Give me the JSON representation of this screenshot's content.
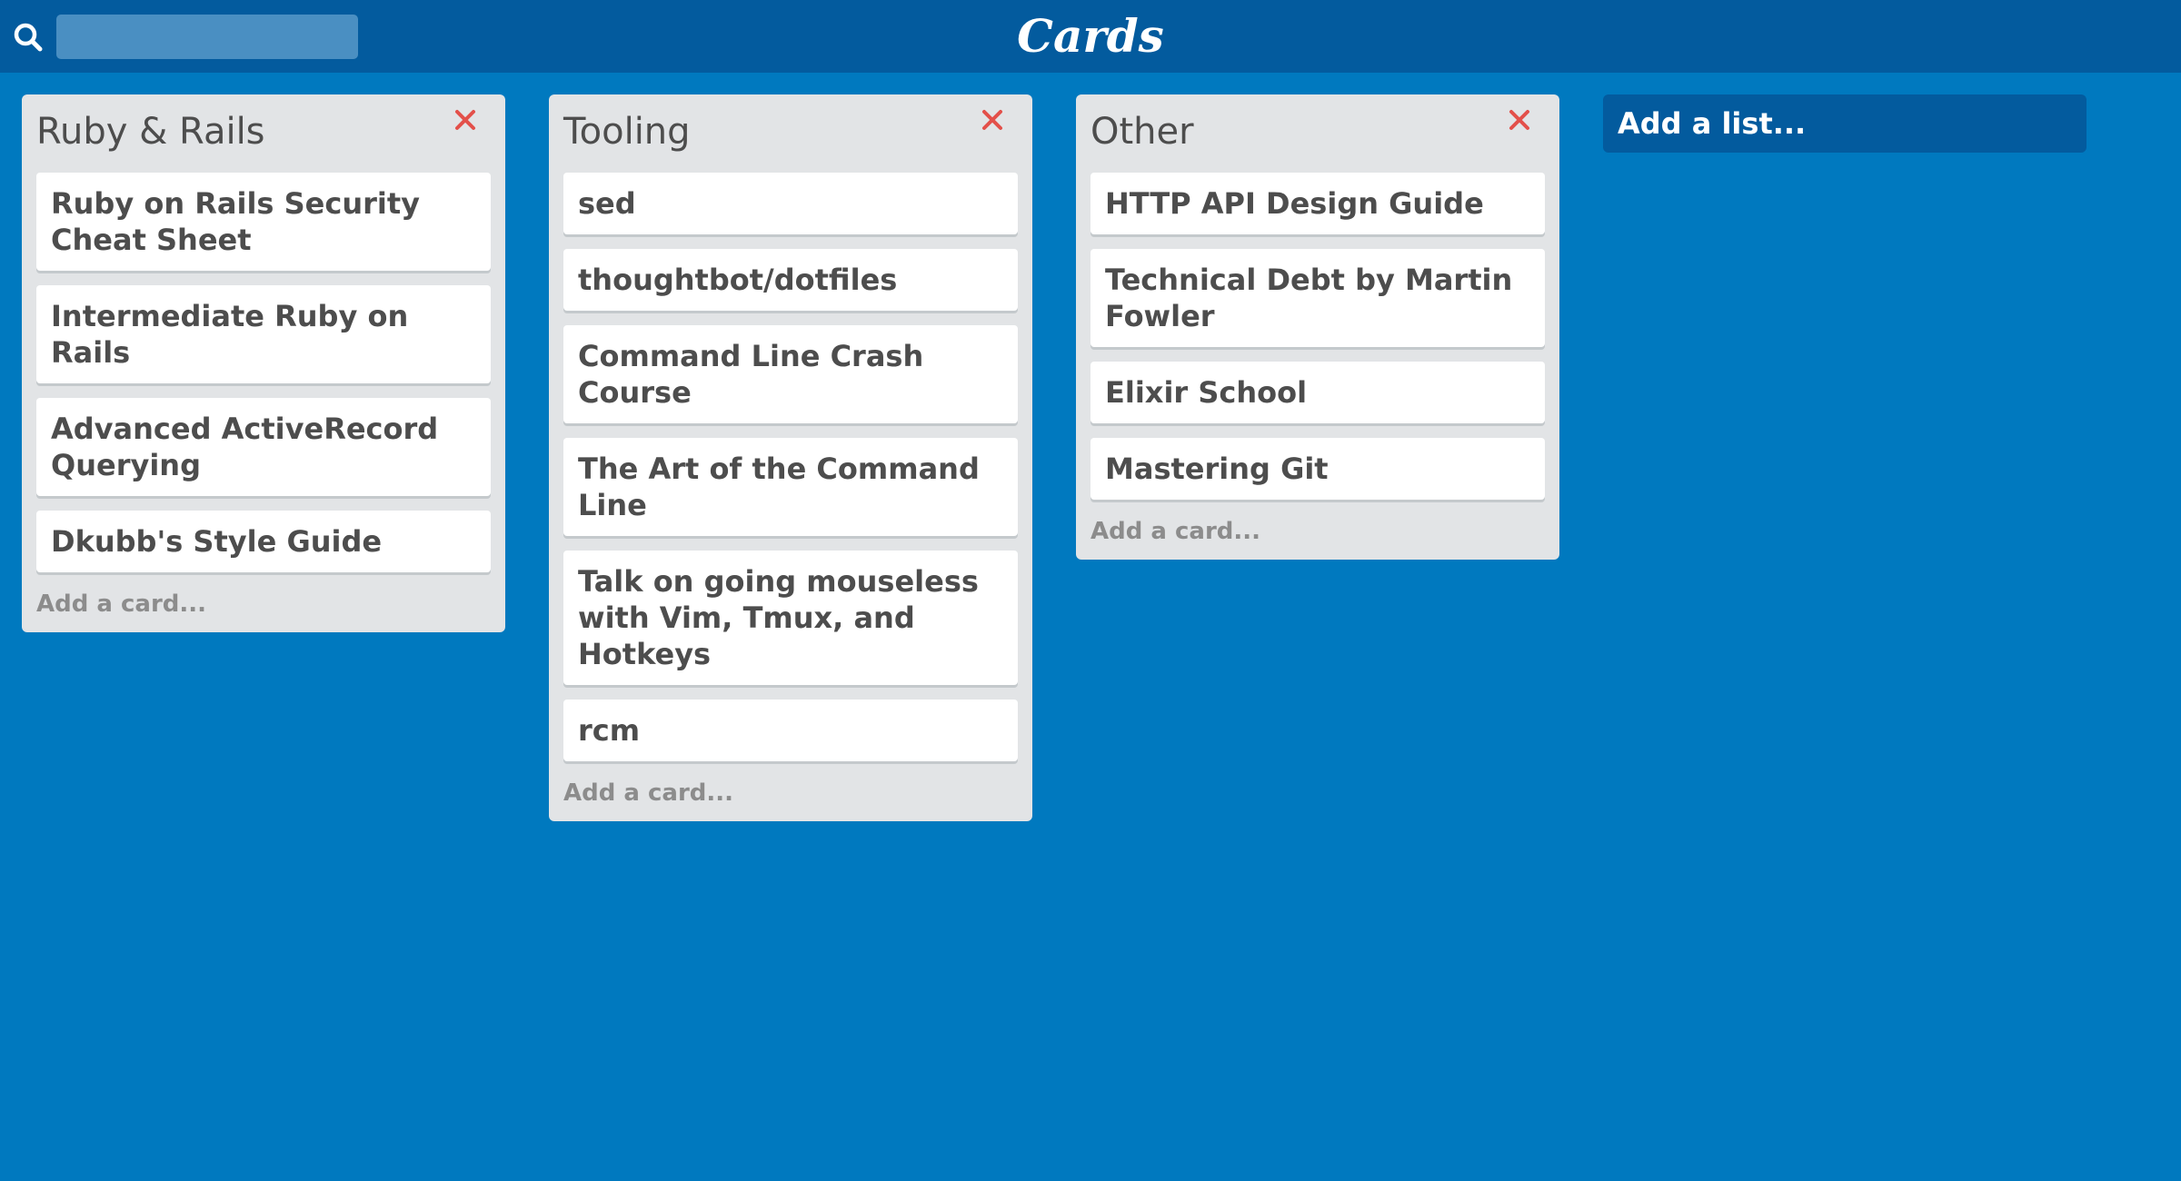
{
  "header": {
    "title": "Cards",
    "search": {
      "value": "",
      "placeholder": ""
    }
  },
  "lists": [
    {
      "title": "Ruby & Rails",
      "cards": [
        "Ruby on Rails Security Cheat Sheet",
        "Intermediate Ruby on Rails",
        "Advanced ActiveRecord Querying",
        "Dkubb's Style Guide"
      ],
      "add_card_label": "Add a card..."
    },
    {
      "title": "Tooling",
      "cards": [
        "sed",
        "thoughtbot/dotfiles",
        "Command Line Crash Course",
        "The Art of the Command Line",
        "Talk on going mouseless with Vim, Tmux, and Hotkeys",
        "rcm"
      ],
      "add_card_label": "Add a card..."
    },
    {
      "title": "Other",
      "cards": [
        "HTTP API Design Guide",
        "Technical Debt by Martin Fowler",
        "Elixir School",
        "Mastering Git"
      ],
      "add_card_label": "Add a card..."
    }
  ],
  "add_list_label": "Add a list...",
  "colors": {
    "background": "#0079bf",
    "header": "#035b9e",
    "list": "#e2e4e6",
    "close": "#e3504a"
  }
}
